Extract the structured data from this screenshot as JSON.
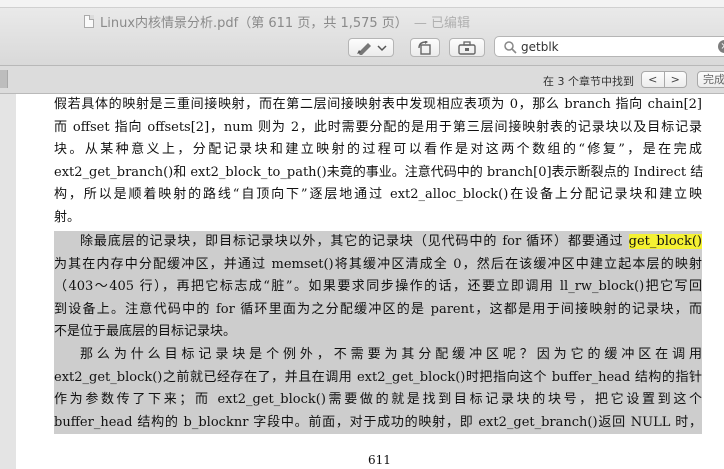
{
  "window": {
    "title": "Linux内核情景分析.pdf（第 611 页，共 1,575 页）",
    "edited_label": "— 已编辑"
  },
  "toolbar": {
    "search_value": "getblk",
    "clear_glyph": "×",
    "icons": [
      "pen-icon",
      "chevron-down-icon",
      "rotate-icon",
      "toolbox-icon",
      "search-icon",
      "clear-icon"
    ]
  },
  "findbar": {
    "status": "在 3 个章节中找到",
    "prev": "<",
    "next": ">",
    "done": "完成"
  },
  "document": {
    "para1": [
      "假若具体的映射是三重间接映射，而在第二层间接映射表中发现相应表项为 0，那么 branch 指向 chain[2]",
      "而 offset 指向 offsets[2]，num 则为 2，此时需要分配的是用于第三层间接映射表的记录块以及目标记录",
      "块。从某种意义上，分配记录块和建立映射的过程可以看作是对这两个数组的“修复”，是在完成",
      "ext2_get_branch()和 ext2_block_to_path()未竟的事业。注意代码中的 branch[0]表示断裂点的 Indirect 结",
      "构，所以是顺着映射的路线“自顶向下”逐层地通过 ext2_alloc_block()在设备上分配记录块和建立映",
      "射。"
    ],
    "para2_line1_prefix": "除最底层的记录块，即目标记录块以外，其它的记录块（见代码中的 for 循环）都要通过 ",
    "para2_line1_match": "get_block()",
    "para2_rest": [
      "为其在内存中分配缓冲区，并通过 memset()将其缓冲区清成全 0，然后在该缓冲区中建立起本层的映射",
      "（403～405 行），再把它标志成“脏”。如果要求同步操作的话，还要立即调用 ll_rw_block()把它写回",
      "到设备上。注意代码中的 for 循环里面为之分配缓冲区的是 parent，这都是用于间接映射的记录块，而",
      "不是位于最底层的目标记录块。"
    ],
    "para3": [
      "那么为什么目标记录块是个例外，不需要为其分配缓冲区呢？因为它的缓冲区在调用",
      "ext2_get_block()之前就已经存在了，并且在调用 ext2_get_block()时把指向这个 buffer_head 结构的指针",
      "作为参数传了下来；而 ext2_get_block()需要做的就是找到目标记录块的块号，把它设置到这个",
      "buffer_head 结构的 b_blocknr 字段中。前面，对于成功的映射，即 ext2_get_branch()返回 NULL 时，"
    ],
    "page_number": "611"
  },
  "colors": {
    "search_highlight": "#f4f133",
    "selection": "#cdcdcd"
  }
}
